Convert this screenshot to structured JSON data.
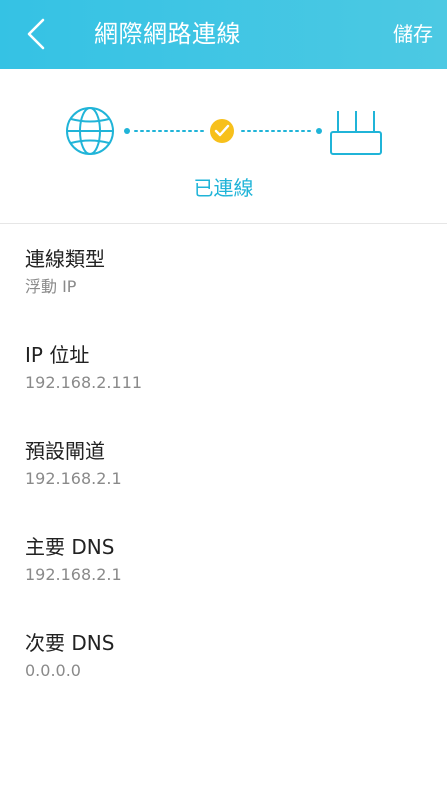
{
  "header": {
    "title": "網際網路連線",
    "save_label": "儲存"
  },
  "status": {
    "text": "已連線",
    "accent_color": "#20b4d8",
    "check_color": "#f7c01b"
  },
  "fields": [
    {
      "label": "連線類型",
      "value": "浮動 IP"
    },
    {
      "label": "IP 位址",
      "value": "192.168.2.111"
    },
    {
      "label": "預設閘道",
      "value": "192.168.2.1"
    },
    {
      "label": "主要 DNS",
      "value": "192.168.2.1"
    },
    {
      "label": "次要 DNS",
      "value": "0.0.0.0"
    }
  ]
}
